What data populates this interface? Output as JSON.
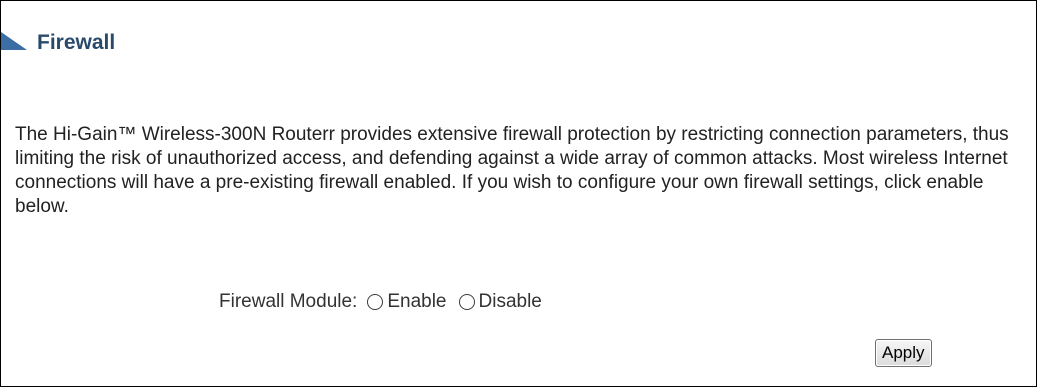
{
  "section": {
    "title": "Firewall"
  },
  "description": "The Hi-Gain™ Wireless-300N Routerr provides extensive firewall protection by restricting connection parameters, thus limiting the risk of unauthorized access, and defending against a wide array of common attacks. Most wireless Internet connections will have a pre-existing firewall enabled. If you wish to configure your own firewall settings, click enable below.",
  "firewall_module": {
    "label": "Firewall Module:",
    "options": [
      {
        "label": "Enable",
        "selected": false
      },
      {
        "label": "Disable",
        "selected": false
      }
    ]
  },
  "apply_label": "Apply",
  "colors": {
    "title": "#2a4a6b",
    "marker": "#3a6ea5"
  },
  "icons": {
    "title_marker": "triangle-marker-icon",
    "radio": "radio-button-icon"
  }
}
